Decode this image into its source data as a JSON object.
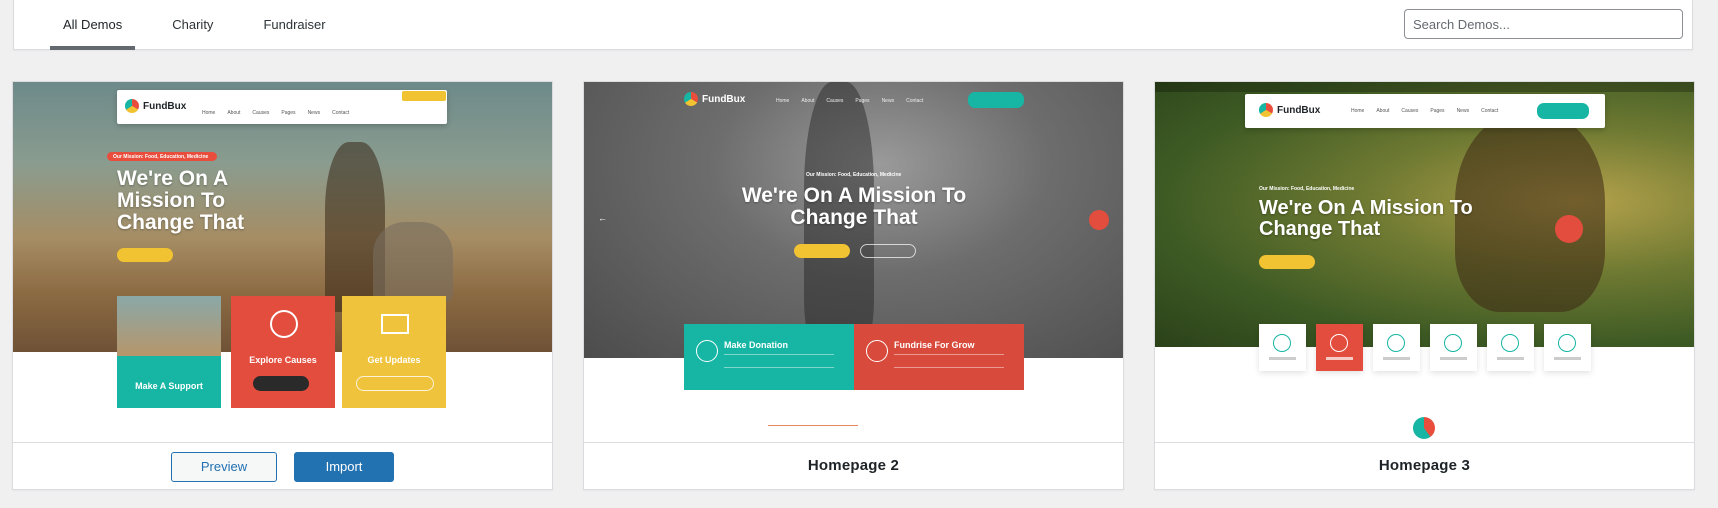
{
  "filters": {
    "tabs": [
      {
        "label": "All Demos",
        "active": true
      },
      {
        "label": "Charity",
        "active": false
      },
      {
        "label": "Fundraiser",
        "active": false
      }
    ],
    "search": {
      "placeholder": "Search Demos..."
    }
  },
  "demos": [
    {
      "preview": {
        "logo": "FundBux",
        "mission_label": "Our Mission: Food, Education, Medicine",
        "headline": "We're On A Mission To Change That",
        "tiles": [
          {
            "label": "Make A Support"
          },
          {
            "label": "Explore Causes"
          },
          {
            "label": "Get Updates"
          }
        ]
      },
      "preview_button": "Preview Demo",
      "import_button": "Import Demo"
    },
    {
      "name": "Homepage 2",
      "preview": {
        "logo": "FundBux",
        "mission_label": "Our Mission: Food, Education, Medicine",
        "headline": "We're On A Mission To Change That",
        "features": [
          {
            "label": "Make Donation"
          },
          {
            "label": "Fundrise For Grow"
          }
        ]
      }
    },
    {
      "name": "Homepage 3",
      "preview": {
        "logo": "FundBux",
        "mission_label": "Our Mission: Food, Education, Medicine",
        "headline": "We're On A Mission To Change That"
      }
    }
  ],
  "colors": {
    "accent_teal": "#16b5a4",
    "accent_red": "#e24d3e",
    "accent_yellow": "#f0c33c",
    "wp_blue": "#2271b1"
  }
}
